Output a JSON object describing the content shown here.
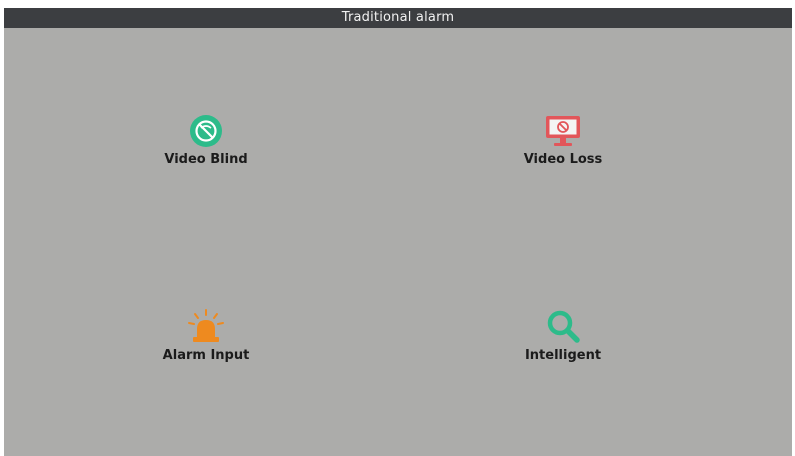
{
  "window": {
    "title": "Traditional alarm"
  },
  "tiles": [
    {
      "label": "Video Blind",
      "icon": "video-blind-icon",
      "color": "#2dbb8a"
    },
    {
      "label": "Video Loss",
      "icon": "monitor-no-signal-icon",
      "color": "#e2565a"
    },
    {
      "label": "Alarm Input",
      "icon": "alarm-light-icon",
      "color": "#ee8a1f"
    },
    {
      "label": "Intelligent",
      "icon": "magnifier-icon",
      "color": "#2dbb8a"
    }
  ]
}
